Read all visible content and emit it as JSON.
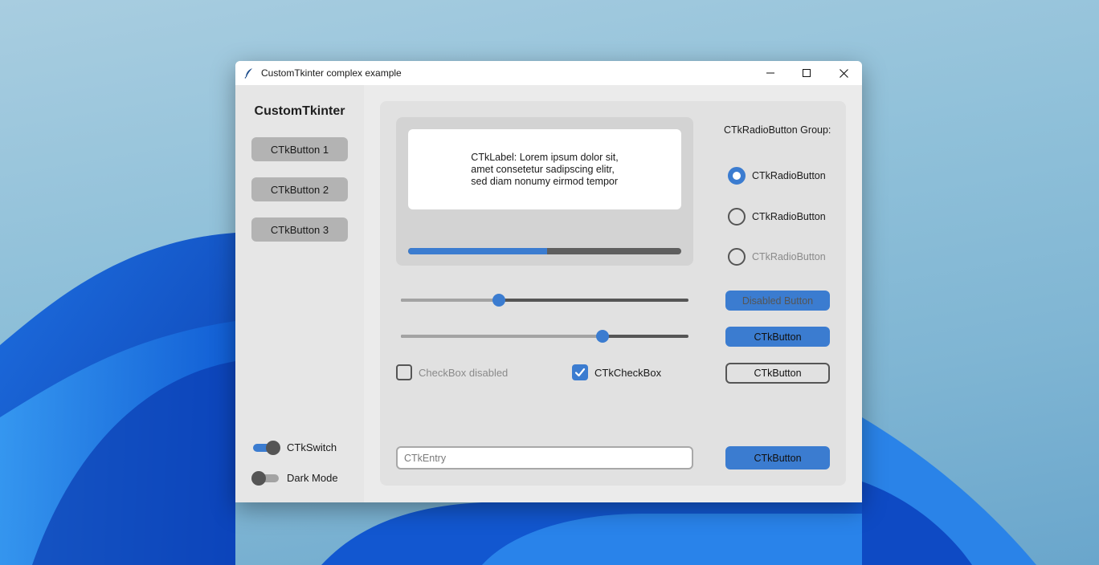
{
  "window": {
    "title": "CustomTkinter complex example"
  },
  "sidebar": {
    "title": "CustomTkinter",
    "buttons": [
      "CTkButton 1",
      "CTkButton 2",
      "CTkButton 3"
    ],
    "switch_label": "CTkSwitch",
    "switch_on": true,
    "dark_mode_label": "Dark Mode",
    "dark_mode_on": false
  },
  "main": {
    "label_text": "CTkLabel: Lorem ipsum dolor sit,\namet consetetur sadipscing elitr,\nsed diam nonumy eirmod tempor",
    "progress": 0.51,
    "slider1": 0.34,
    "slider2": 0.7,
    "checkbox_disabled": {
      "label": "CheckBox disabled",
      "checked": false
    },
    "checkbox": {
      "label": "CTkCheckBox",
      "checked": true
    },
    "entry_placeholder": "CTkEntry",
    "entry_value": ""
  },
  "radio": {
    "title": "CTkRadioButton Group:",
    "options": [
      {
        "label": "CTkRadioButton",
        "selected": true,
        "disabled": false
      },
      {
        "label": "CTkRadioButton",
        "selected": false,
        "disabled": false
      },
      {
        "label": "CTkRadioButton",
        "selected": false,
        "disabled": true
      }
    ]
  },
  "buttons": {
    "disabled_label": "Disabled Button",
    "button_label": "CTkButton",
    "outline_label": "CTkButton",
    "bottom_label": "CTkButton"
  },
  "colors": {
    "accent": "#3b7cd0",
    "disabled_text": "#8a8a8a",
    "sidebar_button": "#b3b3b3"
  },
  "icons": {
    "app": "feather-icon",
    "minimize": "minimize-icon",
    "maximize": "maximize-icon",
    "close": "close-icon",
    "check": "checkmark-icon"
  }
}
